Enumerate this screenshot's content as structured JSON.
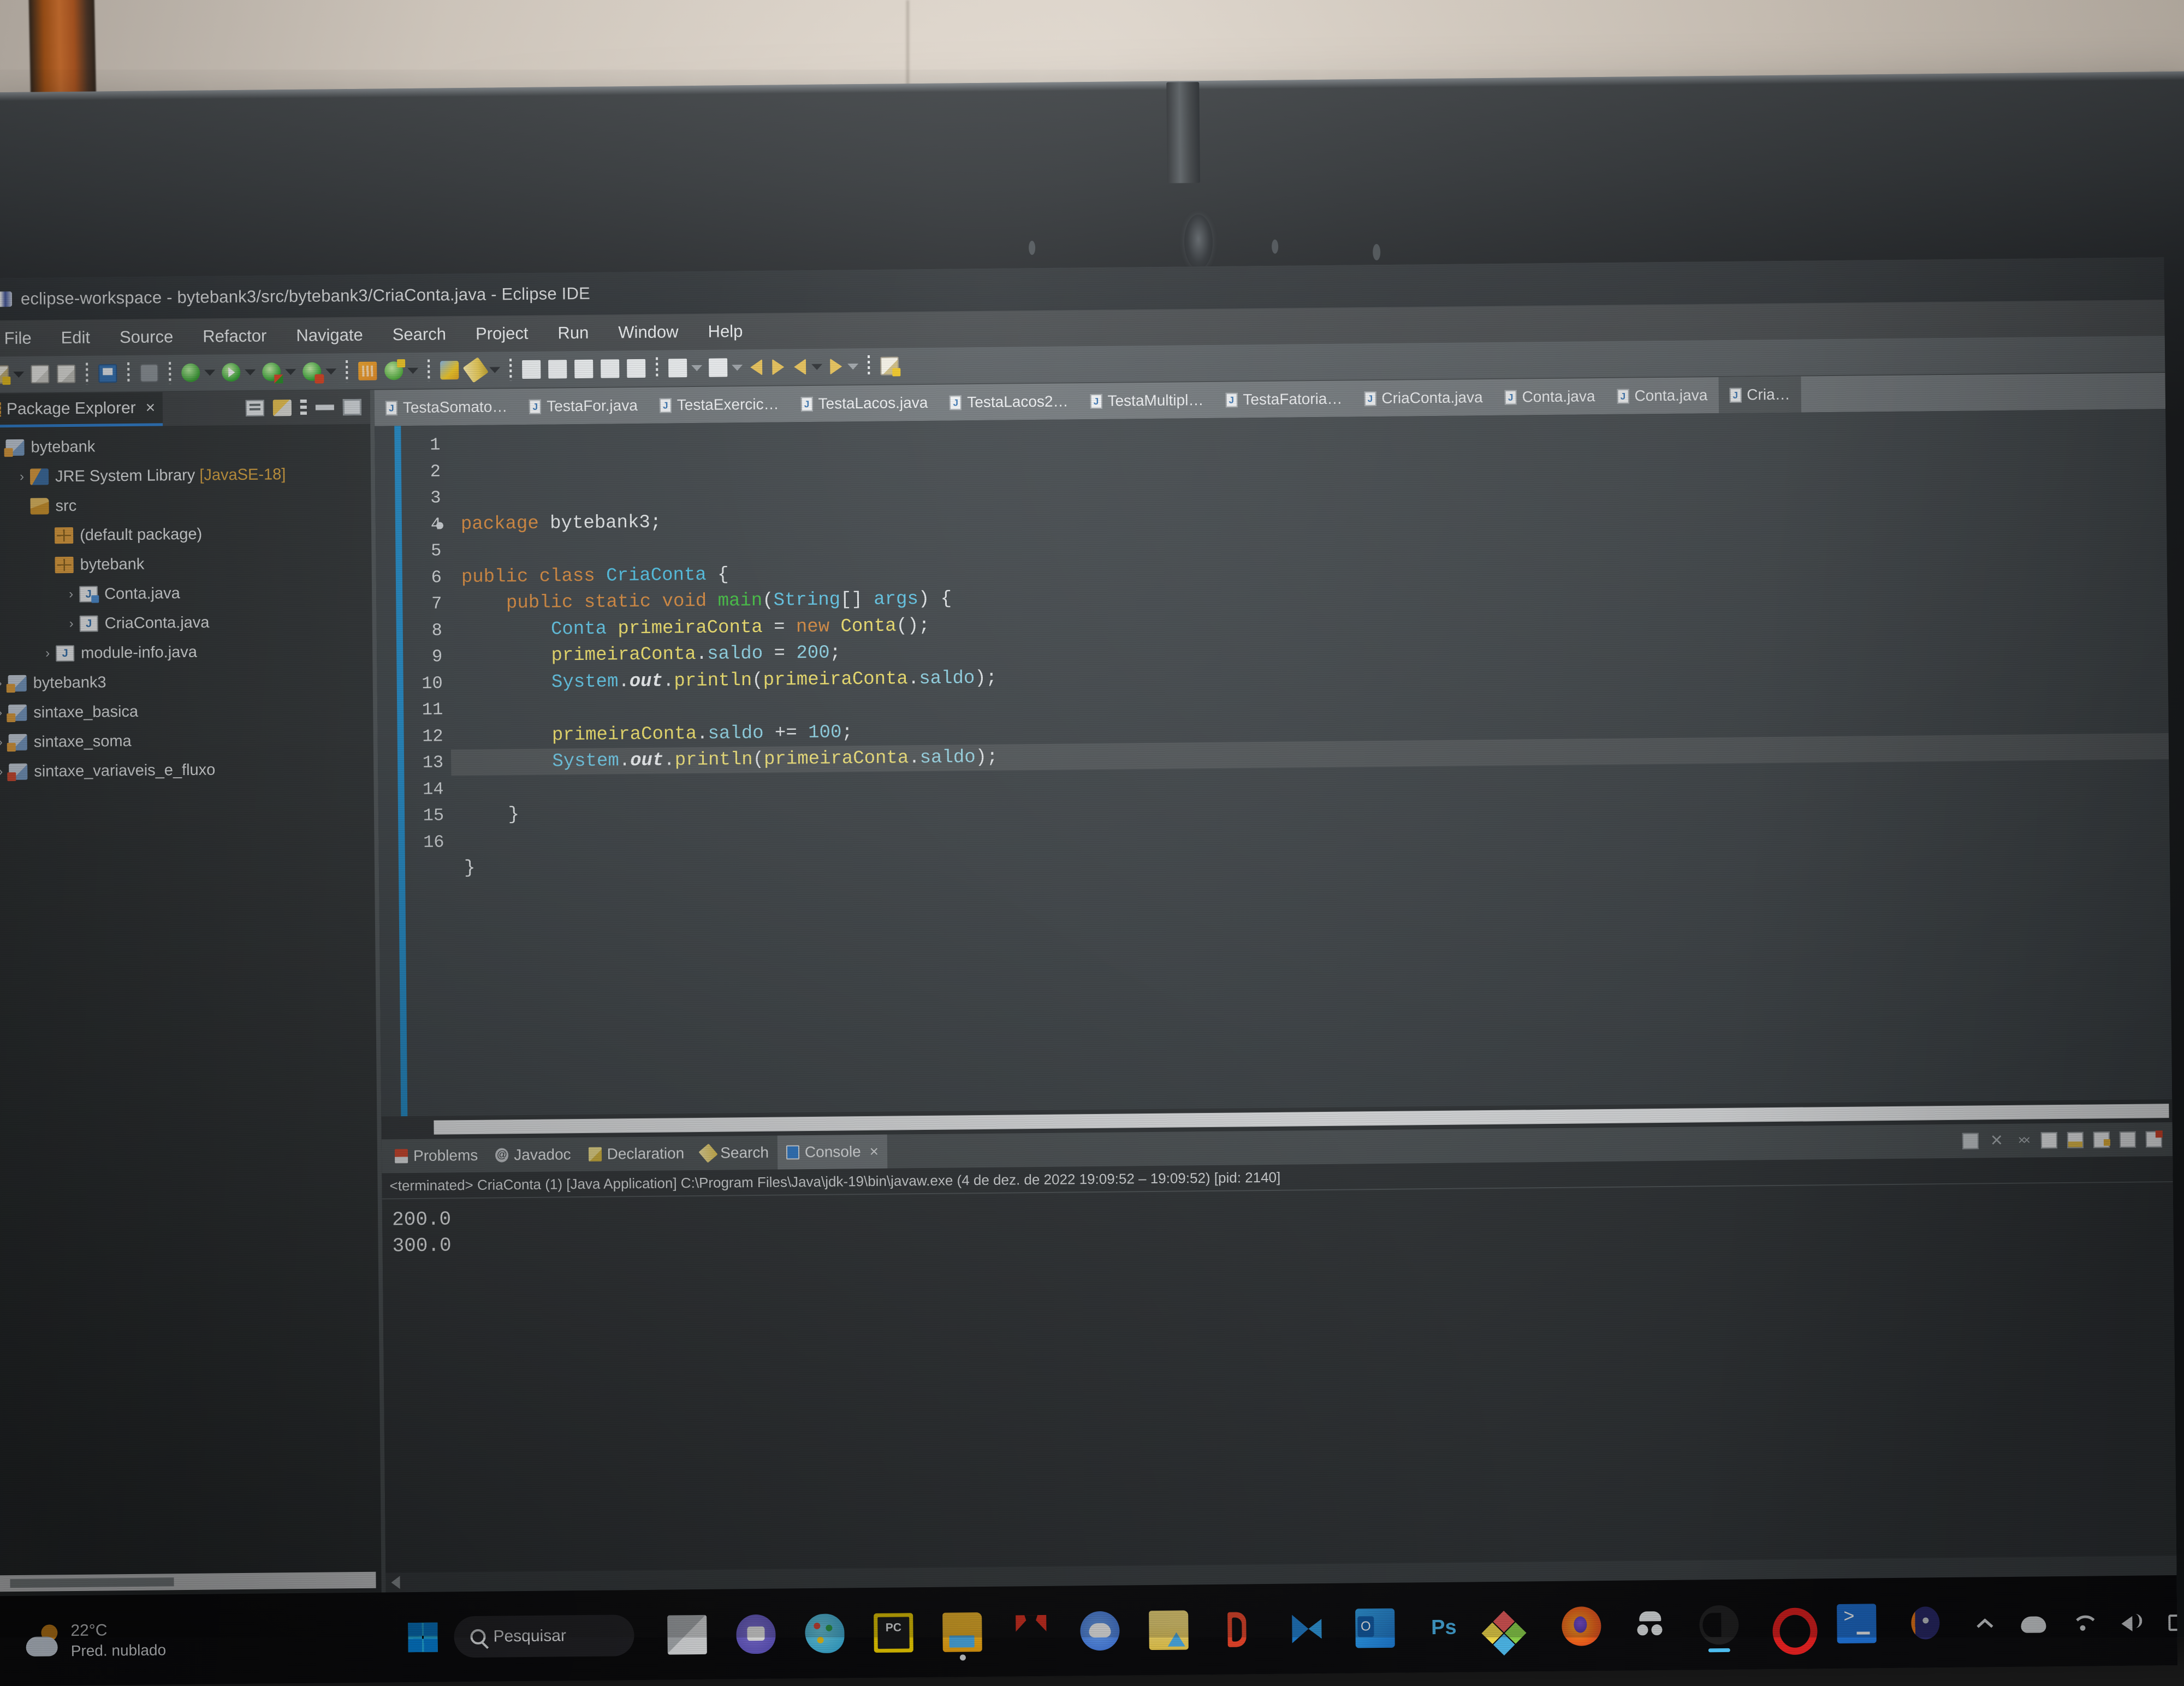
{
  "window": {
    "title": "eclipse-workspace - bytebank3/src/bytebank3/CriaConta.java - Eclipse IDE",
    "logo_icon": "eclipse-logo-icon"
  },
  "menubar": {
    "items": [
      "File",
      "Edit",
      "Source",
      "Refactor",
      "Navigate",
      "Search",
      "Project",
      "Run",
      "Window",
      "Help"
    ]
  },
  "toolbar": {
    "icons": [
      "new-file-icon",
      "dropdown-caret",
      "save-icon",
      "save-all-icon",
      "print-icon",
      "link-icon",
      "debug-icon",
      "dropdown-caret",
      "run-icon",
      "dropdown-caret",
      "run-config-icon",
      "dropdown-caret",
      "coverage-icon",
      "dropdown-caret",
      "new-java-class-icon",
      "new-java-package-icon",
      "dropdown-caret",
      "new-wizard-icon",
      "pencil-icon",
      "dropdown-caret",
      "search-icon",
      "ruler-icon",
      "open-type-icon",
      "open-task-icon",
      "skip-breakpoints-icon",
      "next-annotation-icon",
      "dropdown-caret",
      "previous-annotation-icon",
      "dropdown-caret",
      "back-icon",
      "forward-icon",
      "back-history-icon",
      "dropdown-caret",
      "forward-history-icon",
      "dropdown-caret",
      "pin-editor-icon"
    ]
  },
  "explorer": {
    "tab_label": "Package Explorer",
    "tab_icon": "package-explorer-icon",
    "close_label": "×",
    "tools": [
      "collapse-all-icon",
      "link-with-editor-icon",
      "view-menu-icon",
      "minimize-icon",
      "maximize-icon"
    ],
    "tree": [
      {
        "label": "bytebank",
        "icon": "java-project-icon",
        "indent": 0,
        "chevron": ""
      },
      {
        "label": "JRE System Library ",
        "suffix": "[JavaSE-18]",
        "icon": "jre-library-icon",
        "indent": 1,
        "chevron": "›"
      },
      {
        "label": "src",
        "icon": "source-folder-icon",
        "indent": 1,
        "chevron": ""
      },
      {
        "label": "(default package)",
        "icon": "package-icon",
        "indent": 2,
        "chevron": ""
      },
      {
        "label": "bytebank",
        "icon": "package-icon",
        "indent": 2,
        "chevron": ""
      },
      {
        "label": "Conta.java",
        "icon": "java-file-public-icon",
        "indent": 3,
        "chevron": "›"
      },
      {
        "label": "CriaConta.java",
        "icon": "java-file-icon",
        "indent": 3,
        "chevron": "›"
      },
      {
        "label": "module-info.java",
        "icon": "java-file-icon",
        "indent": 2,
        "chevron": "›"
      },
      {
        "label": "bytebank3",
        "icon": "java-project-icon",
        "indent": 0,
        "chevron": "›"
      },
      {
        "label": "sintaxe_basica",
        "icon": "java-project-icon",
        "indent": 0,
        "chevron": "›"
      },
      {
        "label": "sintaxe_soma",
        "icon": "java-project-icon",
        "indent": 0,
        "chevron": "›"
      },
      {
        "label": "sintaxe_variaveis_e_fluxo",
        "icon": "java-project-red-icon",
        "indent": 0,
        "chevron": "›"
      }
    ]
  },
  "editor": {
    "tabs": [
      {
        "label": "TestaSomato…",
        "active": false
      },
      {
        "label": "TestaFor.java",
        "active": false
      },
      {
        "label": "TestaExercic…",
        "active": false
      },
      {
        "label": "TestaLacos.java",
        "active": false
      },
      {
        "label": "TestaLacos2…",
        "active": false
      },
      {
        "label": "TestaMultipl…",
        "active": false
      },
      {
        "label": "TestaFatoria…",
        "active": false
      },
      {
        "label": "CriaConta.java",
        "active": false
      },
      {
        "label": "Conta.java",
        "active": false
      },
      {
        "label": "Conta.java",
        "active": false
      },
      {
        "label": "Cria…",
        "active": true
      }
    ],
    "line_numbers": [
      "1",
      "2",
      "3",
      "4",
      "5",
      "6",
      "7",
      "8",
      "9",
      "10",
      "11",
      "12",
      "13",
      "14",
      "15",
      "16"
    ],
    "breakpoint_line": "4",
    "current_line": "13",
    "code_lines": [
      {
        "n": 1,
        "tokens": [
          [
            "kw",
            "package"
          ],
          [
            "pln",
            " bytebank3;"
          ]
        ]
      },
      {
        "n": 2,
        "tokens": []
      },
      {
        "n": 3,
        "tokens": [
          [
            "kw",
            "public class "
          ],
          [
            "cls",
            "CriaConta"
          ],
          [
            "pln",
            " {"
          ]
        ]
      },
      {
        "n": 4,
        "tokens": [
          [
            "pln",
            "    "
          ],
          [
            "kw",
            "public static void "
          ],
          [
            "mth",
            "main"
          ],
          [
            "pln",
            "("
          ],
          [
            "type",
            "String"
          ],
          [
            "pln",
            "[] "
          ],
          [
            "type",
            "args"
          ],
          [
            "pln",
            ") {"
          ]
        ]
      },
      {
        "n": 5,
        "tokens": [
          [
            "pln",
            "        "
          ],
          [
            "type",
            "Conta"
          ],
          [
            "pln",
            " "
          ],
          [
            "var",
            "primeiraConta"
          ],
          [
            "pln",
            " = "
          ],
          [
            "kw",
            "new "
          ],
          [
            "var",
            "Conta"
          ],
          [
            "pln",
            "();"
          ]
        ]
      },
      {
        "n": 6,
        "tokens": [
          [
            "pln",
            "        "
          ],
          [
            "var",
            "primeiraConta"
          ],
          [
            "pln",
            "."
          ],
          [
            "fld",
            "saldo"
          ],
          [
            "pln",
            " = "
          ],
          [
            "num",
            "200"
          ],
          [
            "pln",
            ";"
          ]
        ]
      },
      {
        "n": 7,
        "tokens": [
          [
            "pln",
            "        "
          ],
          [
            "type",
            "System"
          ],
          [
            "pln",
            "."
          ],
          [
            "stat",
            "out"
          ],
          [
            "pln",
            "."
          ],
          [
            "var",
            "println"
          ],
          [
            "pln",
            "("
          ],
          [
            "var",
            "primeiraConta"
          ],
          [
            "pln",
            "."
          ],
          [
            "fld",
            "saldo"
          ],
          [
            "pln",
            ");"
          ]
        ]
      },
      {
        "n": 8,
        "tokens": []
      },
      {
        "n": 9,
        "tokens": [
          [
            "pln",
            "        "
          ],
          [
            "var",
            "primeiraConta"
          ],
          [
            "pln",
            "."
          ],
          [
            "fld",
            "saldo"
          ],
          [
            "pln",
            " += "
          ],
          [
            "num",
            "100"
          ],
          [
            "pln",
            ";"
          ]
        ]
      },
      {
        "n": 10,
        "tokens": [
          [
            "pln",
            "        "
          ],
          [
            "type",
            "System"
          ],
          [
            "pln",
            "."
          ],
          [
            "stat",
            "out"
          ],
          [
            "pln",
            "."
          ],
          [
            "var",
            "println"
          ],
          [
            "pln",
            "("
          ],
          [
            "var",
            "primeiraConta"
          ],
          [
            "pln",
            "."
          ],
          [
            "fld",
            "saldo"
          ],
          [
            "pln",
            ");"
          ]
        ]
      },
      {
        "n": 11,
        "tokens": []
      },
      {
        "n": 12,
        "tokens": [
          [
            "pln",
            "    }"
          ]
        ]
      },
      {
        "n": 13,
        "tokens": []
      },
      {
        "n": 14,
        "tokens": [
          [
            "pln",
            "}"
          ]
        ]
      },
      {
        "n": 15,
        "tokens": []
      },
      {
        "n": 16,
        "tokens": []
      }
    ]
  },
  "console": {
    "tabs": [
      {
        "label": "Problems",
        "icon": "problems-icon",
        "active": false
      },
      {
        "label": "Javadoc",
        "icon": "javadoc-icon",
        "active": false
      },
      {
        "label": "Declaration",
        "icon": "declaration-icon",
        "active": false
      },
      {
        "label": "Search",
        "icon": "search-icon",
        "active": false
      },
      {
        "label": "Console",
        "icon": "console-icon",
        "active": true
      }
    ],
    "close_label": "×",
    "tools": [
      "terminate-icon",
      "remove-launch-icon",
      "remove-all-launches-icon",
      "clear-console-icon",
      "scroll-lock-icon",
      "word-wrap-icon",
      "show-console-icon",
      "pin-console-icon"
    ],
    "header": "<terminated> CriaConta (1) [Java Application] C:\\Program Files\\Java\\jdk-19\\bin\\javaw.exe  (4 de dez. de 2022 19:09:52 – 19:09:52) [pid: 2140]",
    "output": [
      "200.0",
      "300.0"
    ]
  },
  "taskbar": {
    "weather": {
      "temperature": "22°C",
      "description": "Pred. nublado",
      "icon": "partly-cloudy-icon"
    },
    "start_icon": "windows-start-icon",
    "search": {
      "label": "Pesquisar",
      "icon": "search-icon"
    },
    "apps": [
      {
        "name": "task-view-icon",
        "cls": "a-taskview",
        "state": ""
      },
      {
        "name": "teams-icon",
        "cls": "a-teams",
        "state": ""
      },
      {
        "name": "paint-icon",
        "cls": "a-paint",
        "state": ""
      },
      {
        "name": "pycharm-icon",
        "cls": "a-pc",
        "state": ""
      },
      {
        "name": "file-explorer-icon",
        "cls": "a-explorer",
        "state": "dotted"
      },
      {
        "name": "mcafee-icon",
        "cls": "a-mcafee",
        "state": ""
      },
      {
        "name": "discord-icon",
        "cls": "a-discord",
        "state": ""
      },
      {
        "name": "folder-icon",
        "cls": "a-folder2",
        "state": ""
      },
      {
        "name": "office-icon",
        "cls": "a-office",
        "state": ""
      },
      {
        "name": "vscode-icon",
        "cls": "a-vscode",
        "state": ""
      },
      {
        "name": "outlook-icon",
        "cls": "a-outlook",
        "state": ""
      },
      {
        "name": "photoshop-icon",
        "cls": "a-ps",
        "state": ""
      },
      {
        "name": "dropbox-icon",
        "cls": "a-dropbox",
        "state": ""
      },
      {
        "name": "firefox-icon",
        "cls": "a-firefox",
        "state": ""
      },
      {
        "name": "incognito-icon",
        "cls": "a-incognito",
        "state": ""
      },
      {
        "name": "edge-icon",
        "cls": "a-edge",
        "state": "active"
      },
      {
        "name": "opera-icon",
        "cls": "a-opera",
        "state": ""
      },
      {
        "name": "powershell-icon",
        "cls": "a-powershell",
        "state": ""
      },
      {
        "name": "eclipse-taskbar-icon",
        "cls": "a-ellipse",
        "state": "dotted"
      }
    ],
    "tray": [
      "chevron-up-icon",
      "onedrive-cloud-icon",
      "wifi-icon",
      "volume-icon",
      "battery-icon"
    ]
  }
}
